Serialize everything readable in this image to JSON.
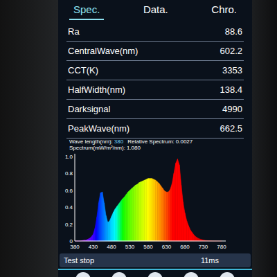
{
  "tabs": [
    {
      "label": "Spec.",
      "selected": true
    },
    {
      "label": "Data.",
      "selected": false
    },
    {
      "label": "Chro.",
      "selected": false
    }
  ],
  "readings": [
    {
      "label": "Ra",
      "value": "88.6"
    },
    {
      "label": "CentralWave(nm)",
      "value": "602.2"
    },
    {
      "label": "CCT(K)",
      "value": "3353"
    },
    {
      "label": "HalfWidth(nm)",
      "value": "138.4"
    },
    {
      "label": "Darksignal",
      "value": "4990"
    },
    {
      "label": "PeakWave(nm)",
      "value": "662.5"
    }
  ],
  "cursor_info": [
    {
      "label": "Wave length(nm):",
      "value": "380"
    },
    {
      "label": "Relative Spectrum:",
      "value": "0.0027"
    },
    {
      "label": "Spectrum(mW/m²/nm):",
      "value": "1.080"
    }
  ],
  "chart": {
    "y_ticks": [
      "1.0",
      "0.8",
      "0.6",
      "0.4",
      "0.2",
      "0"
    ],
    "x_ticks": [
      "380",
      "430",
      "480",
      "530",
      "580",
      "630",
      "680",
      "730",
      "780"
    ],
    "wavelengths": [
      380,
      385,
      390,
      395,
      400,
      405,
      410,
      415,
      420,
      425,
      430,
      435,
      440,
      445,
      450,
      455,
      460,
      465,
      470,
      475,
      480,
      485,
      490,
      495,
      500,
      505,
      510,
      515,
      520,
      525,
      530,
      535,
      540,
      545,
      550,
      555,
      560,
      565,
      570,
      575,
      580,
      585,
      590,
      595,
      600,
      605,
      610,
      615,
      620,
      625,
      630,
      635,
      640,
      645,
      650,
      655,
      660,
      665,
      670,
      675,
      680,
      685,
      690,
      695,
      700,
      705,
      710,
      715,
      720,
      725,
      730,
      735,
      740,
      745,
      750,
      755,
      760,
      765,
      770,
      775,
      780
    ],
    "values": [
      0,
      0,
      0,
      0,
      0.005,
      0.01,
      0.01,
      0.02,
      0.03,
      0.05,
      0.08,
      0.15,
      0.28,
      0.45,
      0.57,
      0.58,
      0.45,
      0.3,
      0.22,
      0.24,
      0.29,
      0.34,
      0.38,
      0.41,
      0.44,
      0.47,
      0.5,
      0.52,
      0.55,
      0.58,
      0.6,
      0.62,
      0.64,
      0.66,
      0.67,
      0.69,
      0.7,
      0.71,
      0.72,
      0.73,
      0.74,
      0.74,
      0.74,
      0.73,
      0.72,
      0.7,
      0.68,
      0.65,
      0.62,
      0.59,
      0.58,
      0.58,
      0.61,
      0.68,
      0.8,
      0.92,
      0.97,
      0.9,
      0.66,
      0.46,
      0.33,
      0.24,
      0.18,
      0.13,
      0.1,
      0.07,
      0.05,
      0.035,
      0.025,
      0.018,
      0.012,
      0.008,
      0.005,
      0.003,
      0.002,
      0.001,
      0,
      0,
      0,
      0,
      0
    ]
  },
  "status_bar": {
    "text": "Test stop",
    "time": "11ms"
  }
}
